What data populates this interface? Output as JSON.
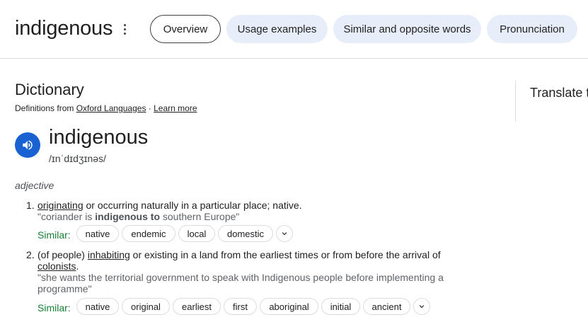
{
  "header": {
    "title": "indigenous",
    "tabs": [
      "Overview",
      "Usage examples",
      "Similar and opposite words",
      "Pronunciation"
    ],
    "active_tab": "Overview"
  },
  "dictionary": {
    "section_title": "Dictionary",
    "source_prefix": "Definitions from ",
    "source_name": "Oxford Languages",
    "separator": " · ",
    "learn_more": "Learn more",
    "headword": "indigenous",
    "phonetic": "/ɪnˈdɪdʒɪnəs/",
    "part_of_speech": "adjective",
    "senses": [
      {
        "number": "1.",
        "def_link": "originating",
        "def_rest": " or occurring naturally in a particular place; native.",
        "example_pre": "\"coriander is ",
        "example_bold": "indigenous to",
        "example_post": " southern Europe\"",
        "similar_label": "Similar:",
        "similar": [
          "native",
          "endemic",
          "local",
          "domestic"
        ]
      },
      {
        "number": "2.",
        "def_prefix": "(of people) ",
        "def_link": "inhabiting",
        "def_rest": " or existing in a land from the earliest times or from before the arrival of",
        "def_link2": "colonists",
        "def_end": ".",
        "example_line1": "\"she wants the territorial government to speak with Indigenous people before implementing a",
        "example_line2": "programme\"",
        "similar_label": "Similar:",
        "similar": [
          "native",
          "original",
          "earliest",
          "first",
          "aboriginal",
          "initial",
          "ancient"
        ]
      }
    ]
  },
  "translate": {
    "label": "Translate t"
  },
  "colors": {
    "accent_blue": "#1a61d2",
    "tab_bg": "#e8eef9",
    "similar_green": "#188038"
  },
  "icons": {
    "kebab": "more-vert-icon",
    "speaker": "volume-icon",
    "expand": "chevron-down-icon"
  }
}
